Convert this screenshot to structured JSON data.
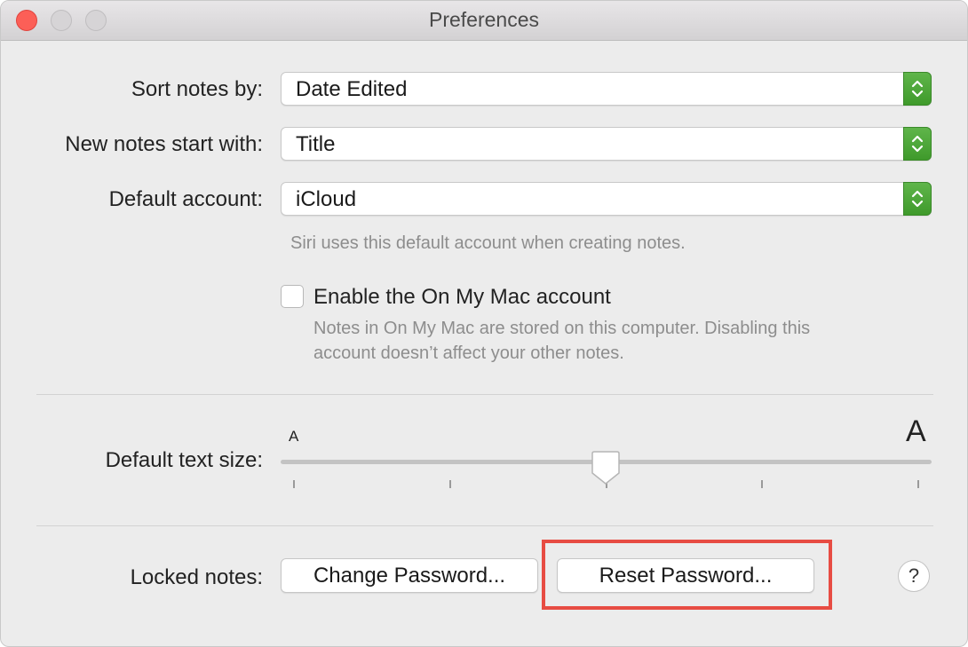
{
  "window": {
    "title": "Preferences"
  },
  "sort": {
    "label": "Sort notes by:",
    "value": "Date Edited"
  },
  "new_notes": {
    "label": "New notes start with:",
    "value": "Title"
  },
  "default_account": {
    "label": "Default account:",
    "value": "iCloud",
    "hint": "Siri uses this default account when creating notes."
  },
  "on_my_mac": {
    "label": "Enable the On My Mac account",
    "checked": false,
    "hint_line1": "Notes in On My Mac are stored on this computer. Disabling this",
    "hint_line2": "account doesn’t affect your other notes."
  },
  "text_size": {
    "label": "Default text size:",
    "small_glyph": "A",
    "large_glyph": "A",
    "steps": 5,
    "selected_step": 2
  },
  "locked_notes": {
    "label": "Locked notes:",
    "change_button": "Change Password...",
    "reset_button": "Reset Password..."
  },
  "help": {
    "label": "?"
  },
  "colors": {
    "accent_stepper": "#4caa36",
    "highlight_box": "#e74c43",
    "close_button": "#fc5f57"
  },
  "icons": [
    "close-icon",
    "minimize-icon",
    "zoom-icon",
    "up-down-chevron-icon",
    "slider-knob-icon",
    "help-icon"
  ]
}
